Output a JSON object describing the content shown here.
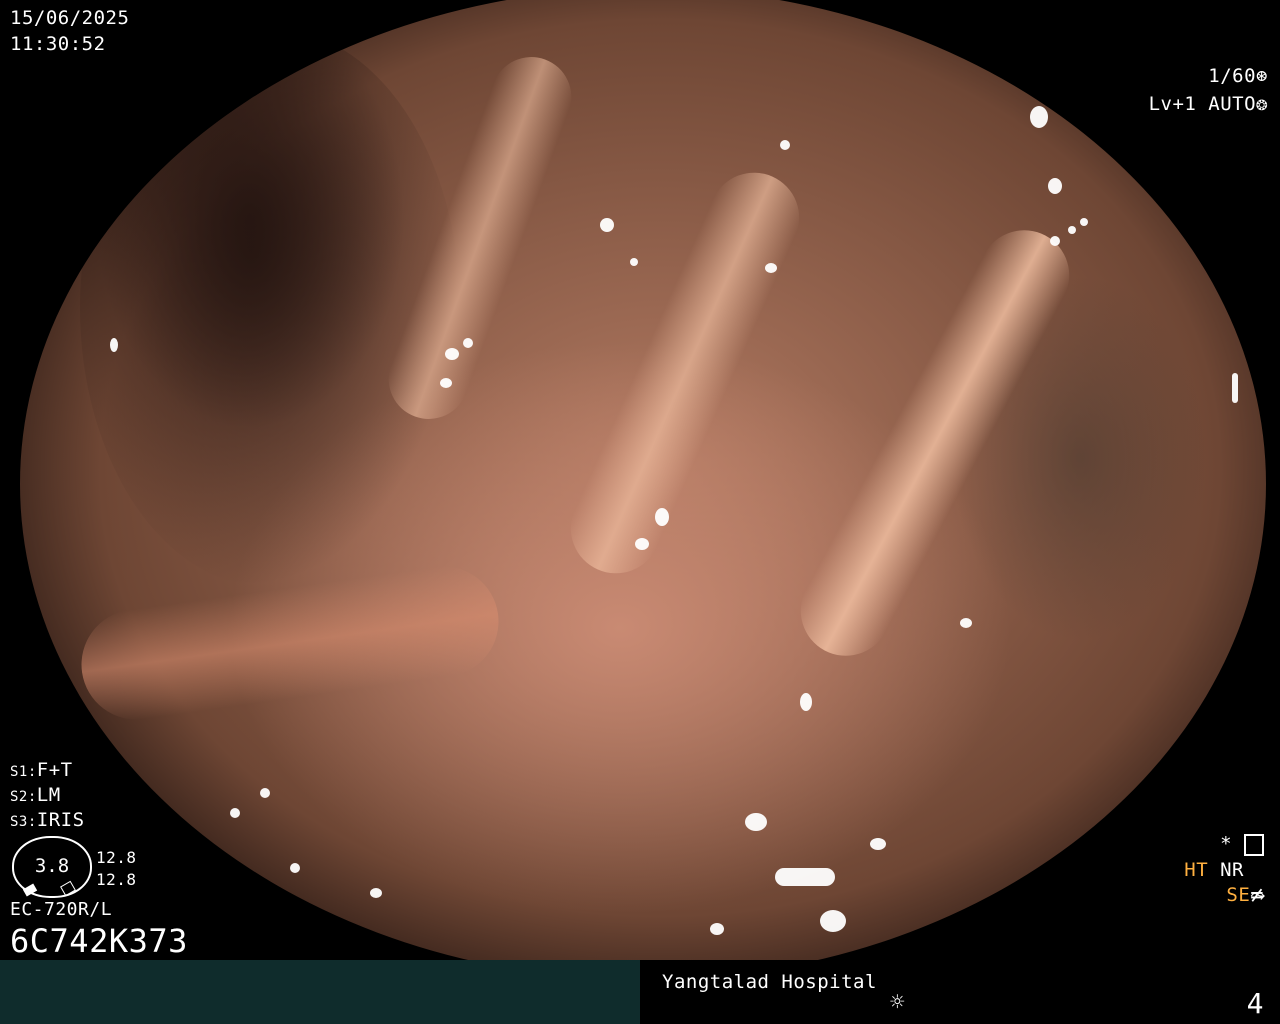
{
  "osd": {
    "date": "15/06/2025",
    "time": "11:30:52",
    "shutter": "1/60",
    "shutter_icon": "aperture-icon",
    "level": "Lv+1",
    "mode": "AUTO",
    "mode_icon": "iris-icon",
    "s1_key": "S1:",
    "s1_value": "F+T",
    "s2_key": "S2:",
    "s2_value": "LM",
    "s3_key": "S3:",
    "s3_value": "IRIS",
    "zoom_value": "3.8",
    "zoom_top": "12.8",
    "zoom_bottom": "12.8",
    "scope_model": "EC-720R/L",
    "scope_serial": "6C742K373",
    "asterisk": "*",
    "settings_icon": "settings-panel-icon",
    "ht_label": "HT",
    "nr_label": "NR",
    "se_label": "SE",
    "se_icon": "curve-icon",
    "bottom_icon": "not-equal-icon",
    "hospital": "Yangtalad Hospital",
    "light_icon": "sun-icon",
    "image_count": "4"
  }
}
